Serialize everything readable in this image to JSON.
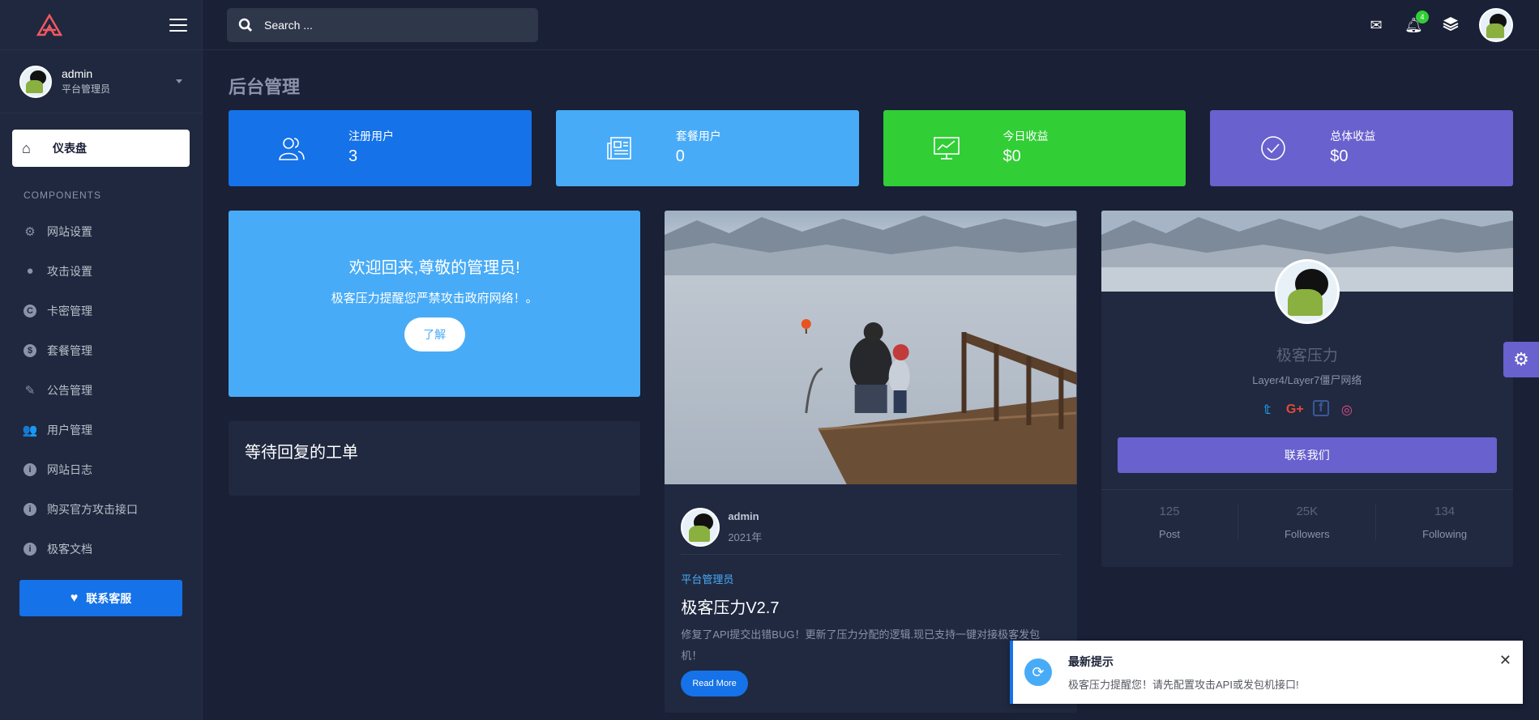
{
  "search": {
    "placeholder": "Search ..."
  },
  "topbar": {
    "notification_count": "4"
  },
  "user": {
    "name": "admin",
    "role": "平台管理员"
  },
  "nav": {
    "active": "仪表盘",
    "section": "COMPONENTS",
    "items": [
      "网站设置",
      "攻击设置",
      "卡密管理",
      "套餐管理",
      "公告管理",
      "用户管理",
      "网站日志",
      "购买官方攻击接口",
      "极客文档"
    ],
    "contact": "联系客服"
  },
  "page": {
    "title": "后台管理"
  },
  "stats": [
    {
      "label": "注册用户",
      "value": "3",
      "color": "#1572e8"
    },
    {
      "label": "套餐用户",
      "value": "0",
      "color": "#48abf7"
    },
    {
      "label": "今日收益",
      "value": "$0",
      "color": "#31ce36"
    },
    {
      "label": "总体收益",
      "value": "$0",
      "color": "#6861ce"
    }
  ],
  "welcome": {
    "title": "欢迎回来,尊敬的管理员!",
    "subtitle": "极客压力提醒您严禁攻击政府网络！。",
    "button": "了解"
  },
  "ticket": {
    "title": "等待回复的工单"
  },
  "blog": {
    "author": "admin",
    "date": "2021年",
    "category": "平台管理员",
    "title": "极客压力V2.7",
    "text": "修复了API提交出错BUG！更新了压力分配的逻辑.现已支持一键对接极客发包机！",
    "read_more": "Read More"
  },
  "profile": {
    "name": "极客压力",
    "subtitle": "Layer4/Layer7僵尸网络",
    "button": "联系我们",
    "stats": [
      {
        "value": "125",
        "label": "Post"
      },
      {
        "value": "25K",
        "label": "Followers"
      },
      {
        "value": "134",
        "label": "Following"
      }
    ]
  },
  "toast": {
    "title": "最新提示",
    "text": "极客压力提醒您！请先配置攻击API或发包机接口!"
  }
}
